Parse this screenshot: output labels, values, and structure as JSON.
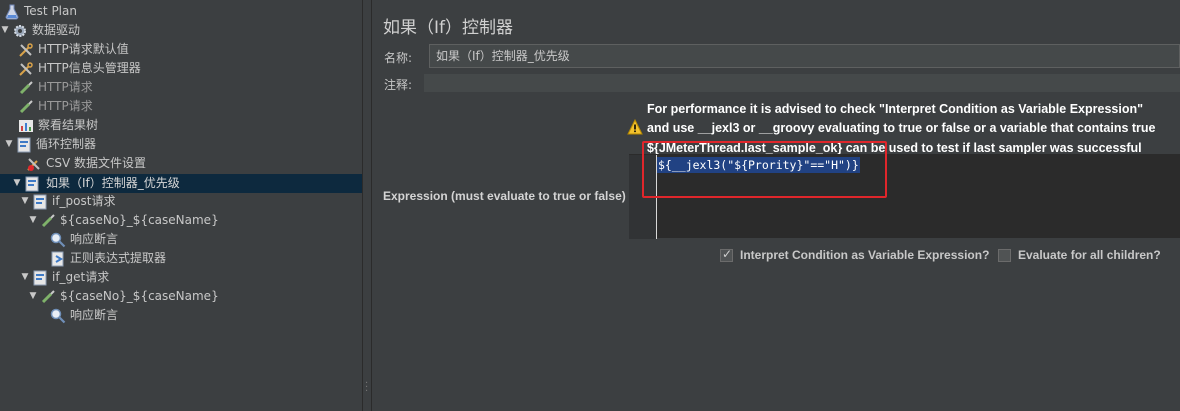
{
  "tree": {
    "items": [
      {
        "label": "Test Plan"
      },
      {
        "label": "数据驱动"
      },
      {
        "label": "HTTP请求默认值"
      },
      {
        "label": "HTTP信息头管理器"
      },
      {
        "label": "HTTP请求"
      },
      {
        "label": "HTTP请求"
      },
      {
        "label": "察看结果树"
      },
      {
        "label": "循环控制器"
      },
      {
        "label": "CSV 数据文件设置"
      },
      {
        "label": "如果（If）控制器_优先级"
      },
      {
        "label": "if_post请求"
      },
      {
        "label": "${caseNo}_${caseName}"
      },
      {
        "label": "响应断言"
      },
      {
        "label": "正则表达式提取器"
      },
      {
        "label": "if_get请求"
      },
      {
        "label": "${caseNo}_${caseName}"
      },
      {
        "label": "响应断言"
      }
    ]
  },
  "panel": {
    "title": "如果（If）控制器",
    "name_label": "名称:",
    "name_value": "如果（If）控制器_优先级",
    "comment_label": "注释:",
    "comment_value": "",
    "warning_line1": "For performance it is advised to check \"Interpret Condition as Variable Expression\"",
    "warning_line2": "and use __jexl3 or __groovy evaluating to true or false or a variable that contains true",
    "warning_line3": "${JMeterThread.last_sample_ok} can be used to test if last sampler was successful",
    "expression_label": "Expression (must evaluate to true or false)",
    "expression_value": "${__jexl3(\"${Prority}\"==\"H\")}",
    "checkbox_interpret_label": "Interpret Condition as Variable Expression?",
    "checkbox_interpret_checked": true,
    "checkbox_evaluate_label": "Evaluate for all children?",
    "checkbox_evaluate_checked": false
  },
  "colors": {
    "background": "#3c3f41",
    "selection": "#0d293e",
    "highlight_box": "#e0262b",
    "code_selection": "#214283"
  }
}
